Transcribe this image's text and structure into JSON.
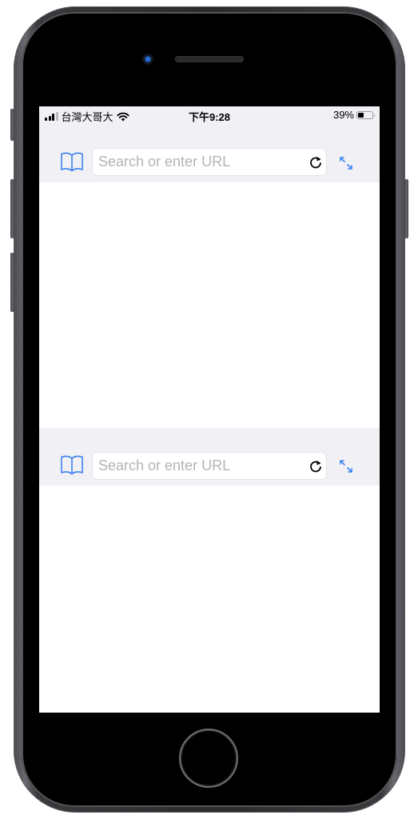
{
  "device": {
    "frame_color": "#2b2b2e",
    "accent_color": "#3b82f0"
  },
  "status_bar": {
    "carrier": "台灣大哥大",
    "time": "下午9:28",
    "battery_percent_label": "39%",
    "battery_level": 0.39,
    "signal_bars": 3,
    "signal_max": 4,
    "wifi_icon": "wifi-icon"
  },
  "top_browser": {
    "bookmarks_icon": "book-icon",
    "url_placeholder": "Search or enter URL",
    "url_value": "",
    "reload_icon": "reload-icon",
    "expand_icon": "expand-arrows-icon"
  },
  "bottom_browser": {
    "bookmarks_icon": "book-icon",
    "url_placeholder": "Search or enter URL",
    "url_value": "",
    "reload_icon": "reload-icon",
    "expand_icon": "expand-arrows-icon"
  }
}
